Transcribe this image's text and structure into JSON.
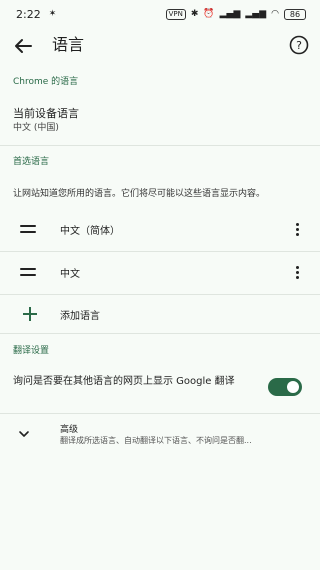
{
  "status_bar": {
    "time": "2:22",
    "indicators": "VPN  ✱  ✖  ▮▮▮  ▮▮▮",
    "battery": "86"
  },
  "app_bar": {
    "title": "语言"
  },
  "sections": {
    "chrome_language_header": "Chrome 的语言",
    "preferred_header": "首选语言",
    "translate_header": "翻译设置"
  },
  "current_device_language": {
    "title": "当前设备语言",
    "value": "中文 (中国)"
  },
  "preferred_description": "让网站知道您所用的语言。它们将尽可能以这些语言显示内容。",
  "languages": [
    {
      "label": "中文（简体）"
    },
    {
      "label": "中文"
    }
  ],
  "add_language_label": "添加语言",
  "translate_setting": {
    "label": "询问是否要在其他语言的网页上显示 Google 翻译",
    "enabled": true
  },
  "advanced": {
    "title": "高级",
    "subtitle": "翻译成所选语言、自动翻译以下语言、不询问是否翻..."
  },
  "colors": {
    "accent": "#2a6a48",
    "background": "#f7fbf7"
  }
}
